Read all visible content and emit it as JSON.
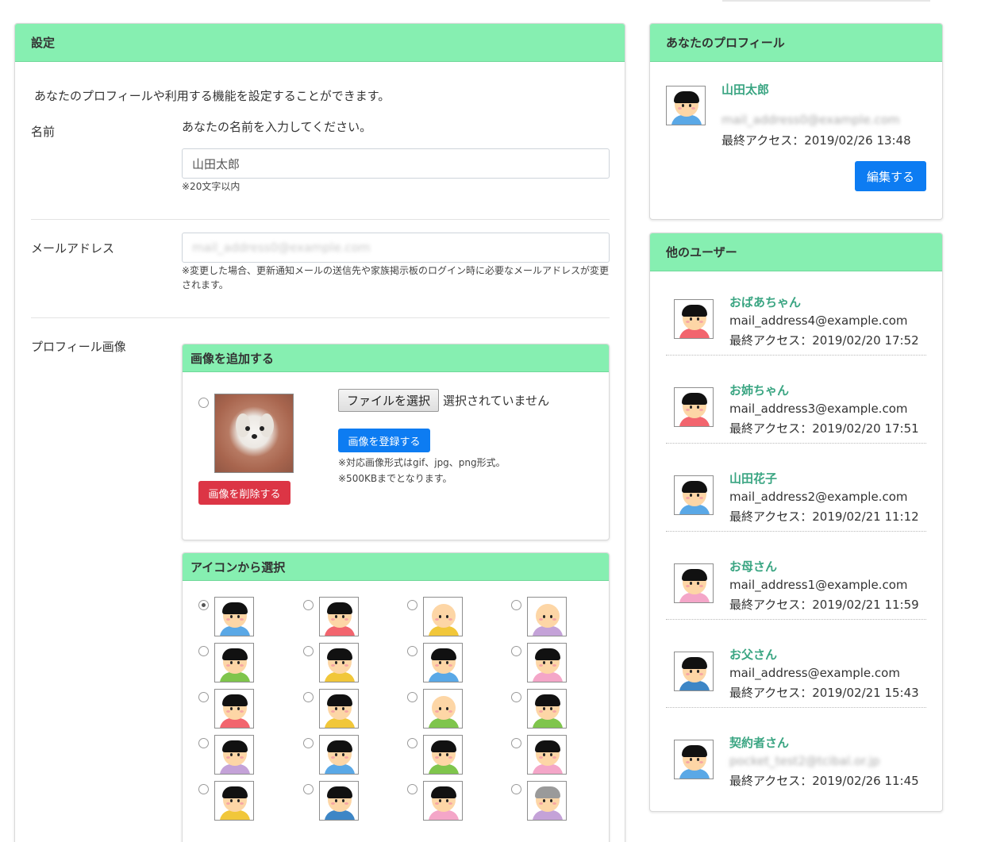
{
  "settings": {
    "title": "設定",
    "intro": "あなたのプロフィールや利用する機能を設定することができます。",
    "name": {
      "label": "名前",
      "help": "あなたの名前を入力してください。",
      "value": "山田太郎",
      "note": "※20文字以内"
    },
    "email": {
      "label": "メールアドレス",
      "value": "mail_address0@example.com",
      "note": "※変更した場合、更新通知メールの送信先や家族掲示板のログイン時に必要なメールアドレスが変更されます。"
    },
    "profile_image": {
      "label": "プロフィール画像",
      "add_title": "画像を追加する",
      "file_button": "ファイルを選択",
      "file_status": "選択されていません",
      "register_button": "画像を登録する",
      "delete_button": "画像を削除する",
      "format_note": "※対応画像形式はgif、jpg、png形式。",
      "size_note": "※500KBまでとなります。",
      "icon_title": "アイコンから選択"
    }
  },
  "icons": [
    {
      "icon": "boy-avatar-icon",
      "hair": "#111111",
      "body": "#5aa8e6",
      "checked": true
    },
    {
      "icon": "girl-avatar-icon",
      "hair": "#111111",
      "body": "#f2656e",
      "checked": false
    },
    {
      "icon": "bald-boy-avatar-icon",
      "hair": "none",
      "body": "#f1c73a",
      "checked": false
    },
    {
      "icon": "bald-child-avatar-icon",
      "hair": "none",
      "body": "#c4a2d8",
      "checked": false
    },
    {
      "icon": "spiky-boy-avatar-icon",
      "hair": "#111111",
      "body": "#7fc54c",
      "checked": false
    },
    {
      "icon": "spiky-boy-yellow-avatar-icon",
      "hair": "#111111",
      "body": "#f1c73a",
      "checked": false
    },
    {
      "icon": "long-hair-girl-avatar-icon",
      "hair": "#111111",
      "body": "#5aa8e6",
      "checked": false
    },
    {
      "icon": "long-hair-girl-pink-avatar-icon",
      "hair": "#111111",
      "body": "#f4a6c8",
      "checked": false
    },
    {
      "icon": "pigtail-girl-avatar-icon",
      "hair": "#111111",
      "body": "#f2656e",
      "checked": false
    },
    {
      "icon": "pigtail-girl-yellow-avatar-icon",
      "hair": "#111111",
      "body": "#f1c73a",
      "checked": false
    },
    {
      "icon": "grandpa-avatar-icon",
      "hair": "none",
      "body": "#7fc54c",
      "checked": false
    },
    {
      "icon": "woman-avatar-icon",
      "hair": "#111111",
      "body": "#7fc54c",
      "checked": false
    },
    {
      "icon": "ponytail-girl-avatar-icon",
      "hair": "#111111",
      "body": "#c4a2d8",
      "checked": false
    },
    {
      "icon": "glasses-woman-avatar-icon",
      "hair": "#111111",
      "body": "#5aa8e6",
      "checked": false
    },
    {
      "icon": "glasses-man-avatar-icon",
      "hair": "#111111",
      "body": "#7fc54c",
      "checked": false
    },
    {
      "icon": "glasses-woman-pink-avatar-icon",
      "hair": "#111111",
      "body": "#f4a6c8",
      "checked": false
    },
    {
      "icon": "glasses-girl-avatar-icon",
      "hair": "#111111",
      "body": "#f1c73a",
      "checked": false
    },
    {
      "icon": "businessman-avatar-icon",
      "hair": "#111111",
      "body": "#3d86c6",
      "checked": false
    },
    {
      "icon": "mother-avatar-icon",
      "hair": "#111111",
      "body": "#f4a6c8",
      "checked": false
    },
    {
      "icon": "grandma-avatar-icon",
      "hair": "#9a9a9a",
      "body": "#c4a2d8",
      "checked": false
    }
  ],
  "profile": {
    "title": "あなたのプロフィール",
    "name": "山田太郎",
    "email": "mail_address0@example.com",
    "last_access": "最終アクセス：2019/02/26 13:48",
    "edit_button": "編集する",
    "avatar_body": "#5aa8e6"
  },
  "others": {
    "title": "他のユーザー",
    "users": [
      {
        "name": "おばあちゃん",
        "email": "mail_address4@example.com",
        "last_access": "最終アクセス：2019/02/20 17:52",
        "body": "#f2656e",
        "blurred": false
      },
      {
        "name": "お姉ちゃん",
        "email": "mail_address3@example.com",
        "last_access": "最終アクセス：2019/02/20 17:51",
        "body": "#f2656e",
        "blurred": false
      },
      {
        "name": "山田花子",
        "email": "mail_address2@example.com",
        "last_access": "最終アクセス：2019/02/21 11:12",
        "body": "#5aa8e6",
        "blurred": false
      },
      {
        "name": "お母さん",
        "email": "mail_address1@example.com",
        "last_access": "最終アクセス：2019/02/21 11:59",
        "body": "#f4a6c8",
        "blurred": false
      },
      {
        "name": "お父さん",
        "email": "mail_address@example.com",
        "last_access": "最終アクセス：2019/02/21 15:43",
        "body": "#3d86c6",
        "blurred": false
      },
      {
        "name": "契約者さん",
        "email": "pocket_test2@tcibal.or.jp",
        "last_access": "最終アクセス：2019/02/26 11:45",
        "body": "#5aa8e6",
        "blurred": true
      }
    ]
  },
  "colors": {
    "accent_header": "#86efb1",
    "link": "#3aa582",
    "primary": "#0d7cf2",
    "danger": "#dc3545"
  }
}
